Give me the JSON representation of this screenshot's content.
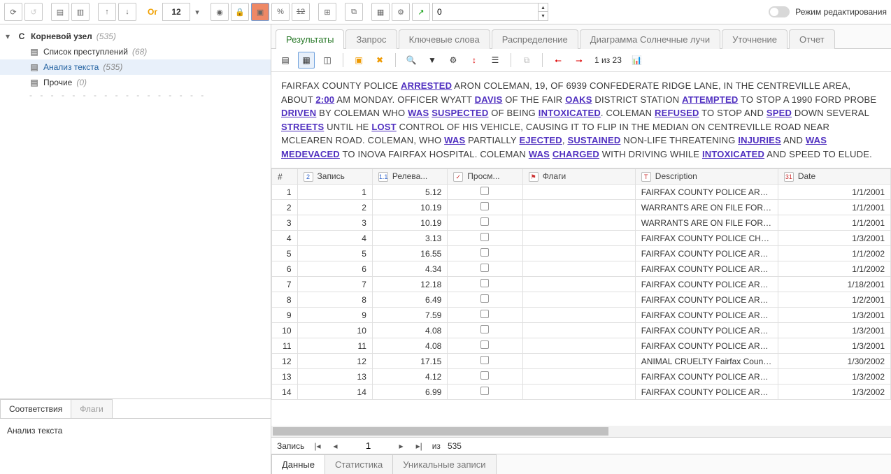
{
  "toolbar": {
    "or_label": "Or",
    "number_box": "12",
    "slash_num": "12",
    "spin_value": "0",
    "edit_mode_label": "Режим редактирования"
  },
  "tree": {
    "root": {
      "label": "Корневой узел",
      "count": "(535)"
    },
    "children": [
      {
        "label": "Список преступлений",
        "count": "(68)"
      },
      {
        "label": "Анализ текста",
        "count": "(535)"
      },
      {
        "label": "Прочие",
        "count": "(0)"
      }
    ]
  },
  "left_tabs": {
    "tab1": "Соответствия",
    "tab2": "Флаги",
    "body": "Анализ текста"
  },
  "main_tabs": [
    "Результаты",
    "Запрос",
    "Ключевые слова",
    "Распределение",
    "Диаграмма Солнечные лучи",
    "Уточнение",
    "Отчет"
  ],
  "sub_toolbar": {
    "position": "1 из 23"
  },
  "article": {
    "parts": [
      {
        "t": "FAIRFAX COUNTY POLICE "
      },
      {
        "k": "ARRESTED"
      },
      {
        "t": " ARON COLEMAN, 19, OF 6939 CONFEDERATE RIDGE LANE, IN THE CENTREVILLE AREA, ABOUT "
      },
      {
        "k": "2:00"
      },
      {
        "t": " AM MONDAY. OFFICER WYATT "
      },
      {
        "k": "DAVIS"
      },
      {
        "t": " OF THE FAIR "
      },
      {
        "k": "OAKS"
      },
      {
        "t": " DISTRICT STATION "
      },
      {
        "k": "ATTEMPTED"
      },
      {
        "t": " TO STOP A 1990 FORD PROBE "
      },
      {
        "k": "DRIVEN"
      },
      {
        "t": " BY COLEMAN WHO "
      },
      {
        "k": "WAS"
      },
      {
        "t": " "
      },
      {
        "k": "SUSPECTED"
      },
      {
        "t": " OF BEING "
      },
      {
        "k": "INTOXICATED"
      },
      {
        "t": ". COLEMAN "
      },
      {
        "k": "REFUSED"
      },
      {
        "t": " TO STOP AND "
      },
      {
        "k": "SPED"
      },
      {
        "t": " DOWN SEVERAL "
      },
      {
        "k": "STREETS"
      },
      {
        "t": " UNTIL HE "
      },
      {
        "k": "LOST"
      },
      {
        "t": " CONTROL OF HIS VEHICLE, CAUSING IT TO FLIP IN THE MEDIAN ON CENTREVILLE ROAD NEAR MCLEAREN ROAD. COLEMAN, WHO "
      },
      {
        "k": "WAS"
      },
      {
        "t": " PARTIALLY "
      },
      {
        "k": "EJECTED"
      },
      {
        "t": ", "
      },
      {
        "k": "SUSTAINED"
      },
      {
        "t": " NON-LIFE THREATENING "
      },
      {
        "k": "INJURIES"
      },
      {
        "t": " AND "
      },
      {
        "k": "WAS"
      },
      {
        "t": " "
      },
      {
        "k": "MEDEVACED"
      },
      {
        "t": " TO INOVA FAIRFAX HOSPITAL. COLEMAN "
      },
      {
        "k": "WAS"
      },
      {
        "t": " "
      },
      {
        "k": "CHARGED"
      },
      {
        "t": " WITH DRIVING WHILE "
      },
      {
        "k": "INTOXICATED"
      },
      {
        "t": " AND SPEED TO ELUDE."
      }
    ]
  },
  "grid": {
    "headers": {
      "rownum": "#",
      "record": "Запись",
      "relev": "Релева...",
      "view": "Просм...",
      "flags": "Флаги",
      "desc": "Description",
      "date": "Date"
    },
    "rows": [
      {
        "n": "1",
        "rec": "1",
        "rel": "5.12",
        "desc": "FAIRFAX COUNTY POLICE ARRESTE",
        "date": "1/1/2001"
      },
      {
        "n": "2",
        "rec": "2",
        "rel": "10.19",
        "desc": "WARRANTS ARE ON FILE FOR EDU",
        "date": "1/1/2001"
      },
      {
        "n": "3",
        "rec": "3",
        "rel": "10.19",
        "desc": "WARRANTS ARE ON FILE FOR EDU",
        "date": "1/1/2001"
      },
      {
        "n": "4",
        "rec": "4",
        "rel": "3.13",
        "desc": "FAIRFAX COUNTY POLICE CHARGE",
        "date": "1/3/2001"
      },
      {
        "n": "5",
        "rec": "5",
        "rel": "16.55",
        "desc": "FAIRFAX COUNTY POLICE ARE INVE",
        "date": "1/1/2002"
      },
      {
        "n": "6",
        "rec": "6",
        "rel": "4.34",
        "desc": "FAIRFAX COUNTY POLICE ARRESTE",
        "date": "1/1/2002"
      },
      {
        "n": "7",
        "rec": "7",
        "rel": "12.18",
        "desc": "FAIRFAX COUNTY POLICE ARRESTE",
        "date": "1/18/2001"
      },
      {
        "n": "8",
        "rec": "8",
        "rel": "6.49",
        "desc": "FAIRFAX COUNTY POLICE ARE INVE",
        "date": "1/2/2001"
      },
      {
        "n": "9",
        "rec": "9",
        "rel": "7.59",
        "desc": "FAIRFAX COUNTY POLICE ARRESTE",
        "date": "1/3/2001"
      },
      {
        "n": "10",
        "rec": "10",
        "rel": "4.08",
        "desc": "FAIRFAX COUNTY POLICE ARRESTE",
        "date": "1/3/2001"
      },
      {
        "n": "11",
        "rec": "11",
        "rel": "4.08",
        "desc": "FAIRFAX COUNTY POLICE ARRESTE",
        "date": "1/3/2001"
      },
      {
        "n": "12",
        "rec": "12",
        "rel": "17.15",
        "desc": "ANIMAL CRUELTY Fairfax County P",
        "date": "1/30/2002"
      },
      {
        "n": "13",
        "rec": "13",
        "rel": "4.12",
        "desc": "FAIRFAX COUNTY POLICE ARE INVE",
        "date": "1/3/2002"
      },
      {
        "n": "14",
        "rec": "14",
        "rel": "6.99",
        "desc": "FAIRFAX COUNTY POLICE ARRESTE",
        "date": "1/3/2002"
      }
    ]
  },
  "navbar": {
    "label": "Запись",
    "current": "1",
    "of": "из",
    "total": "535"
  },
  "bottom_tabs": [
    "Данные",
    "Статистика",
    "Уникальные записи"
  ]
}
